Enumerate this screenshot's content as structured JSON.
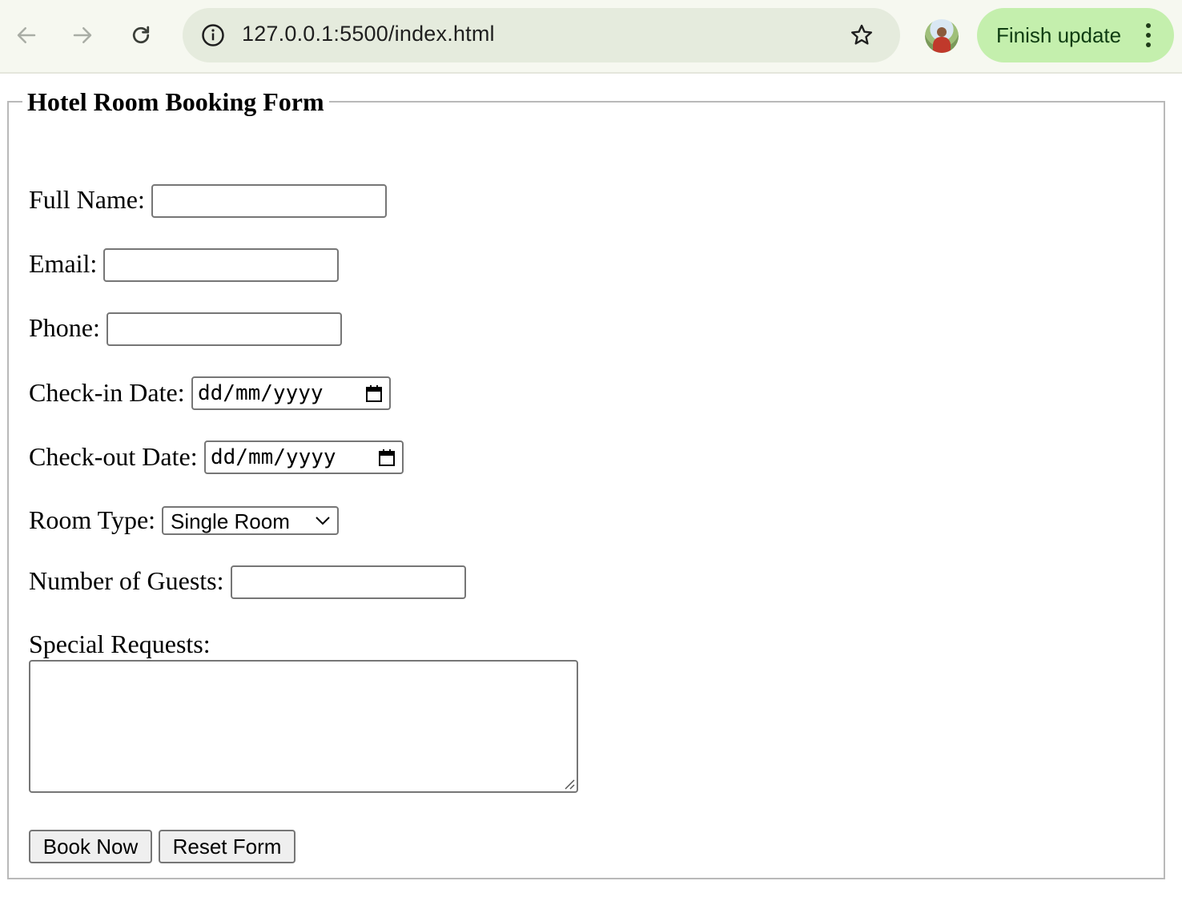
{
  "browser": {
    "url": "127.0.0.1:5500/index.html",
    "update_button_label": "Finish update",
    "icons": {
      "back": "arrow-left-icon",
      "forward": "arrow-right-icon",
      "reload": "reload-icon",
      "site_info": "info-icon",
      "bookmark": "star-icon",
      "menu": "kebab-menu-icon"
    }
  },
  "form": {
    "legend": "Hotel Room Booking Form",
    "fields": {
      "full_name": {
        "label": "Full Name:",
        "value": ""
      },
      "email": {
        "label": "Email:",
        "value": ""
      },
      "phone": {
        "label": "Phone:",
        "value": ""
      },
      "check_in": {
        "label": "Check-in Date:",
        "placeholder": "dd/mm/yyyy"
      },
      "check_out": {
        "label": "Check-out Date:",
        "placeholder": "dd/mm/yyyy"
      },
      "room_type": {
        "label": "Room Type:",
        "selected": "Single Room"
      },
      "guests": {
        "label": "Number of Guests:",
        "value": ""
      },
      "special_requests": {
        "label": "Special Requests:",
        "value": ""
      }
    },
    "buttons": {
      "submit": "Book Now",
      "reset": "Reset Form"
    }
  },
  "colors": {
    "toolbar_bg": "#f6f8f0",
    "omnibox_bg": "#e5ebdd",
    "update_pill_bg": "#c4efad",
    "input_border": "#767676",
    "fieldset_border": "#b9b9b9"
  }
}
